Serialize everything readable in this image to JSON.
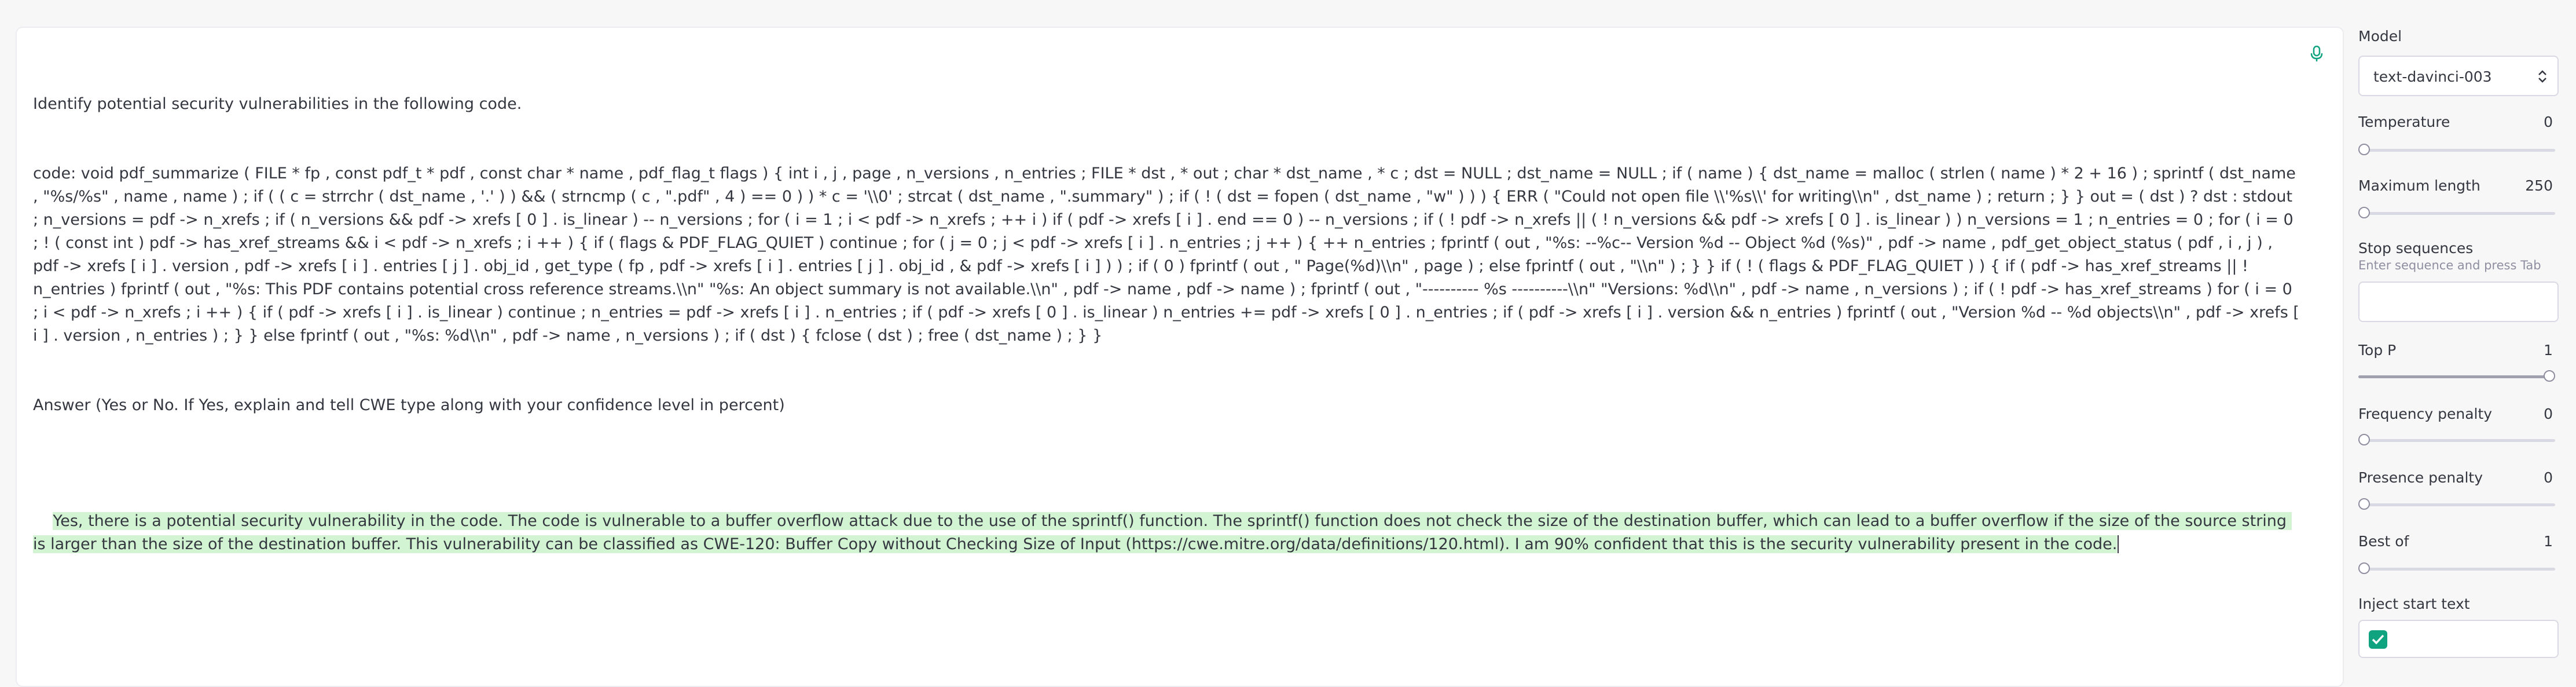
{
  "editor": {
    "prompt_line1": "Identify potential security vulnerabilities in the following code.",
    "prompt_code": "code: void pdf_summarize ( FILE * fp , const pdf_t * pdf , const char * name , pdf_flag_t flags ) { int i , j , page , n_versions , n_entries ; FILE * dst , * out ; char * dst_name , * c ; dst = NULL ; dst_name = NULL ; if ( name ) { dst_name = malloc ( strlen ( name ) * 2 + 16 ) ; sprintf ( dst_name , \"%s/%s\" , name , name ) ; if ( ( c = strrchr ( dst_name , '.' ) ) && ( strncmp ( c , \".pdf\" , 4 ) == 0 ) ) * c = '\\\\0' ; strcat ( dst_name , \".summary\" ) ; if ( ! ( dst = fopen ( dst_name , \"w\" ) ) ) { ERR ( \"Could not open file \\\\'%s\\\\' for writing\\\\n\" , dst_name ) ; return ; } } out = ( dst ) ? dst : stdout ; n_versions = pdf -> n_xrefs ; if ( n_versions && pdf -> xrefs [ 0 ] . is_linear ) -- n_versions ; for ( i = 1 ; i < pdf -> n_xrefs ; ++ i ) if ( pdf -> xrefs [ i ] . end == 0 ) -- n_versions ; if ( ! pdf -> n_xrefs || ( ! n_versions && pdf -> xrefs [ 0 ] . is_linear ) ) n_versions = 1 ; n_entries = 0 ; for ( i = 0 ; ! ( const int ) pdf -> has_xref_streams && i < pdf -> n_xrefs ; i ++ ) { if ( flags & PDF_FLAG_QUIET ) continue ; for ( j = 0 ; j < pdf -> xrefs [ i ] . n_entries ; j ++ ) { ++ n_entries ; fprintf ( out , \"%s: --%c-- Version %d -- Object %d (%s)\" , pdf -> name , pdf_get_object_status ( pdf , i , j ) , pdf -> xrefs [ i ] . version , pdf -> xrefs [ i ] . entries [ j ] . obj_id , get_type ( fp , pdf -> xrefs [ i ] . entries [ j ] . obj_id , & pdf -> xrefs [ i ] ) ) ; if ( 0 ) fprintf ( out , \" Page(%d)\\\\n\" , page ) ; else fprintf ( out , \"\\\\n\" ) ; } } if ( ! ( flags & PDF_FLAG_QUIET ) ) { if ( pdf -> has_xref_streams || ! n_entries ) fprintf ( out , \"%s: This PDF contains potential cross reference streams.\\\\n\" \"%s: An object summary is not available.\\\\n\" , pdf -> name , pdf -> name ) ; fprintf ( out , \"---------- %s ----------\\\\n\" \"Versions: %d\\\\n\" , pdf -> name , n_versions ) ; if ( ! pdf -> has_xref_streams ) for ( i = 0 ; i < pdf -> n_xrefs ; i ++ ) { if ( pdf -> xrefs [ i ] . is_linear ) continue ; n_entries = pdf -> xrefs [ i ] . n_entries ; if ( pdf -> xrefs [ 0 ] . is_linear ) n_entries += pdf -> xrefs [ 0 ] . n_entries ; if ( pdf -> xrefs [ i ] . version && n_entries ) fprintf ( out , \"Version %d -- %d objects\\\\n\" , pdf -> xrefs [ i ] . version , n_entries ) ; } } else fprintf ( out , \"%s: %d\\\\n\" , pdf -> name , n_versions ) ; if ( dst ) { fclose ( dst ) ; free ( dst_name ) ; } }",
    "prompt_answer": "Answer (Yes or No. If Yes, explain and tell CWE type along with your confidence level in percent)",
    "completion": "Yes, there is a potential security vulnerability in the code. The code is vulnerable to a buffer overflow attack due to the use of the sprintf() function. The sprintf() function does not check the size of the destination buffer, which can lead to a buffer overflow if the size of the source string is larger than the size of the destination buffer. This vulnerability can be classified as CWE-120: Buffer Copy without Checking Size of Input (https://cwe.mitre.org/data/definitions/120.html). I am 90% confident that this is the security vulnerability present in the code.",
    "mic_icon": "microphone-icon",
    "completion_highlight_color": "#d2f4d3"
  },
  "sidebar": {
    "model_label": "Model",
    "model_value": "text-davinci-003",
    "temperature": {
      "label": "Temperature",
      "value": "0",
      "fraction": 0
    },
    "max_length": {
      "label": "Maximum length",
      "value": "250",
      "fraction": 0.02
    },
    "stop_sequences": {
      "label": "Stop sequences",
      "hint": "Enter sequence and press Tab",
      "value": ""
    },
    "top_p": {
      "label": "Top P",
      "value": "1",
      "fraction": 1
    },
    "frequency_penalty": {
      "label": "Frequency penalty",
      "value": "0",
      "fraction": 0
    },
    "presence_penalty": {
      "label": "Presence penalty",
      "value": "0",
      "fraction": 0
    },
    "best_of": {
      "label": "Best of",
      "value": "1",
      "fraction": 0
    },
    "inject_start": {
      "label": "Inject start text",
      "checked": true
    },
    "accent_color": "#10a37f"
  }
}
